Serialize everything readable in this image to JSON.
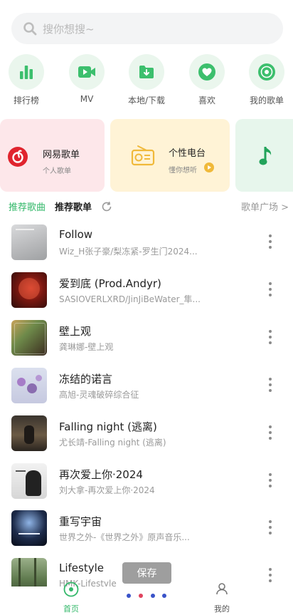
{
  "search": {
    "placeholder": "搜你想搜~"
  },
  "quick": [
    {
      "label": "排行榜",
      "icon": "bar-chart-icon"
    },
    {
      "label": "MV",
      "icon": "video-icon"
    },
    {
      "label": "本地/下载",
      "icon": "download-folder-icon"
    },
    {
      "label": "喜欢",
      "icon": "heart-icon"
    },
    {
      "label": "我的歌单",
      "icon": "disc-icon"
    }
  ],
  "cards": {
    "netease": {
      "title": "网易歌单",
      "subtitle": "个人歌单"
    },
    "radio": {
      "title": "个性电台",
      "subtitle": "懂你想听"
    }
  },
  "section": {
    "tab_recommend_songs": "推荐歌曲",
    "tab_recommend_playlists": "推荐歌单",
    "more_link": "歌单广场 >"
  },
  "songs": [
    {
      "title": "Follow",
      "artist": "Wiz_H张子豪/梨冻紧-罗生门2024..."
    },
    {
      "title": "爱到底 (Prod.Andyr)",
      "artist": "SASIOVERLXRD/JinJiBeWater_隼..."
    },
    {
      "title": "壁上观",
      "artist": "龚琳娜-壁上观"
    },
    {
      "title": "冻结的诺言",
      "artist": "高旭-灵魂破碎综合征"
    },
    {
      "title": "Falling night (逃离)",
      "artist": "尤长靖-Falling night (逃离)"
    },
    {
      "title": "再次爱上你·2024",
      "artist": "刘大拿-再次爱上你·2024"
    },
    {
      "title": "重写宇宙",
      "artist": "世界之外-《世界之外》原声音乐..."
    },
    {
      "title": "Lifestyle",
      "artist": "HMK-Lifestyle"
    }
  ],
  "save_label": "保存",
  "bottom_nav": {
    "home": "首页",
    "mine": "我的"
  },
  "colors": {
    "accent": "#33b86a",
    "card_pink": "#fde7ea",
    "card_yellow": "#fff3d6",
    "card_green": "#e7f6ec"
  }
}
